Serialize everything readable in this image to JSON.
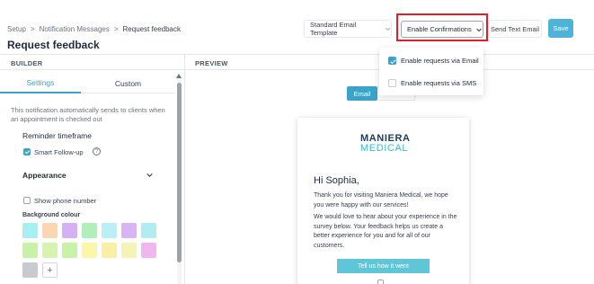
{
  "header": {
    "breadcrumb": [
      "Setup",
      "Notification Messages",
      "Request feedback"
    ],
    "breadcrumb_sep": ">",
    "title": "Request feedback",
    "template_select": "Standard Email Template",
    "enable_confirmations": "Enable Confirmations",
    "send_text_email": "Send Text Email",
    "save": "Save"
  },
  "dropdown": {
    "items": [
      {
        "label": "Enable requests via Email",
        "checked": true
      },
      {
        "label": "Enable requests via SMS",
        "checked": false
      }
    ]
  },
  "builder": {
    "section_label": "BUILDER",
    "tabs": [
      "Settings",
      "Custom"
    ],
    "note": "This notification automatically sends to clients when an appointment is checked out",
    "reminder_timeframe": "Reminder timeframe",
    "smart_followup": "Smart Follow-up",
    "help": "?",
    "appearance": "Appearance",
    "show_phone": "Show phone number",
    "background_colour": "Background colour",
    "add": "+",
    "swatches": [
      "#a8eef5",
      "#fad7b0",
      "#d5b0f4",
      "#b0f0b8",
      "#b8f0f5",
      "#d8b4f5",
      "#b0ecf0",
      "#c7f3a6",
      "#d6f3b0",
      "#c7f3a6",
      "#fbf6a8",
      "#f9f0a6",
      "#f5f3b5",
      "#f1b6ef",
      "#c7cbd1"
    ]
  },
  "preview": {
    "section_label": "PREVIEW",
    "toggle_email": "Email",
    "email": {
      "logo_line1": "MANIERA",
      "logo_line2": "MEDICAL",
      "greeting": "Hi Sophia,",
      "para1": "Thank you for visiting Maniera Medical, we hope you were happy with our services!",
      "para2": "We would love to hear about your experience in the survey below. Your feedback helps us create a better experience for you and for all of our customers.",
      "cta": "Tell us how it went"
    }
  }
}
